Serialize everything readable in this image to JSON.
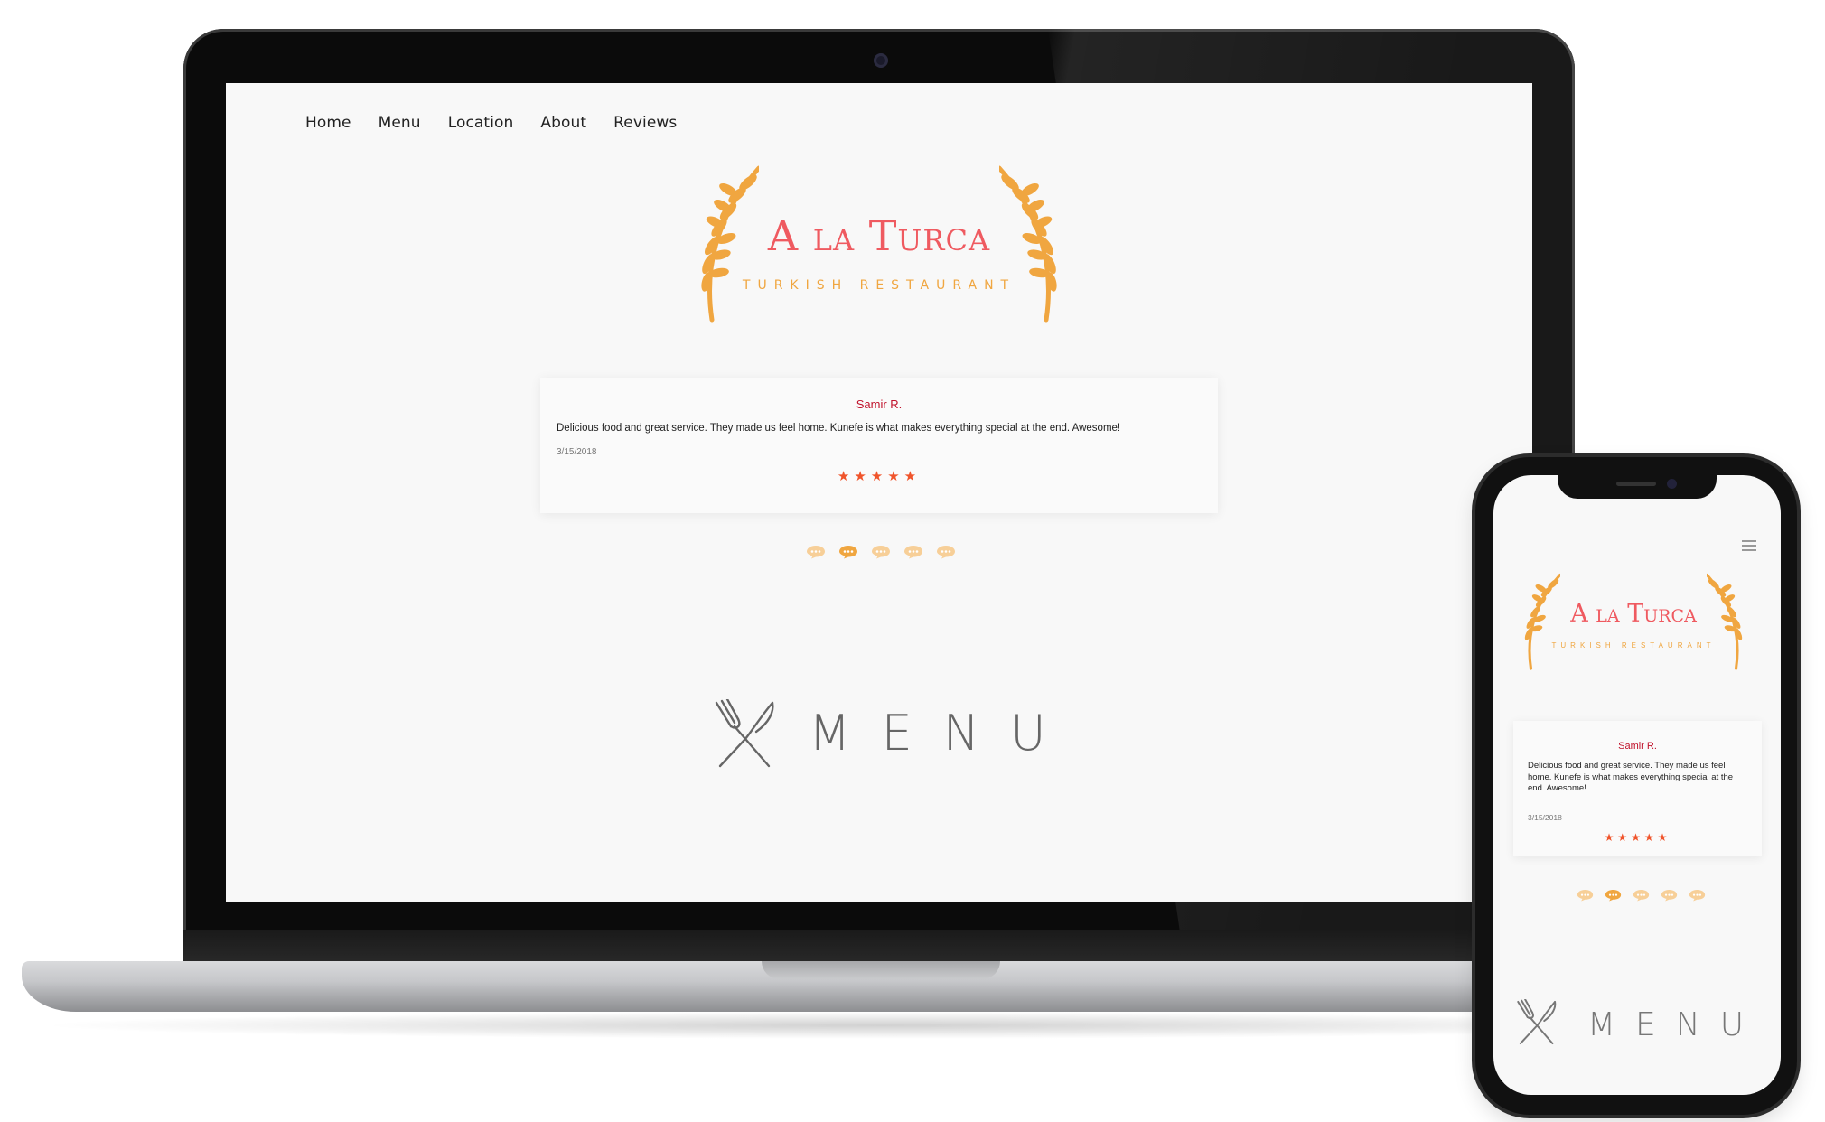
{
  "brand": {
    "name": "A la Turca",
    "tagline": "TURKISH RESTAURANT",
    "title_color": "#ef5a60",
    "wheat_color": "#f0a640"
  },
  "nav": {
    "items": [
      {
        "label": "Home"
      },
      {
        "label": "Menu"
      },
      {
        "label": "Location"
      },
      {
        "label": "About"
      },
      {
        "label": "Reviews"
      }
    ]
  },
  "review": {
    "author": "Samir R.",
    "text": "Delicious food and great service. They made us feel home. Kunefe is what makes everything special at the end. Awesome!",
    "date": "3/15/2018",
    "stars": "★★★★★",
    "rating": 5,
    "star_color": "#f0542b"
  },
  "review_pager": {
    "count": 5,
    "active_index": 1,
    "icon": "speech-bubble-icon",
    "active_color": "#f0a640",
    "inactive_color": "#f7cf98"
  },
  "menu_section": {
    "label": "MENU",
    "icon": "fork-knife-icon"
  },
  "mobile": {
    "menu_icon": "hamburger-icon"
  }
}
